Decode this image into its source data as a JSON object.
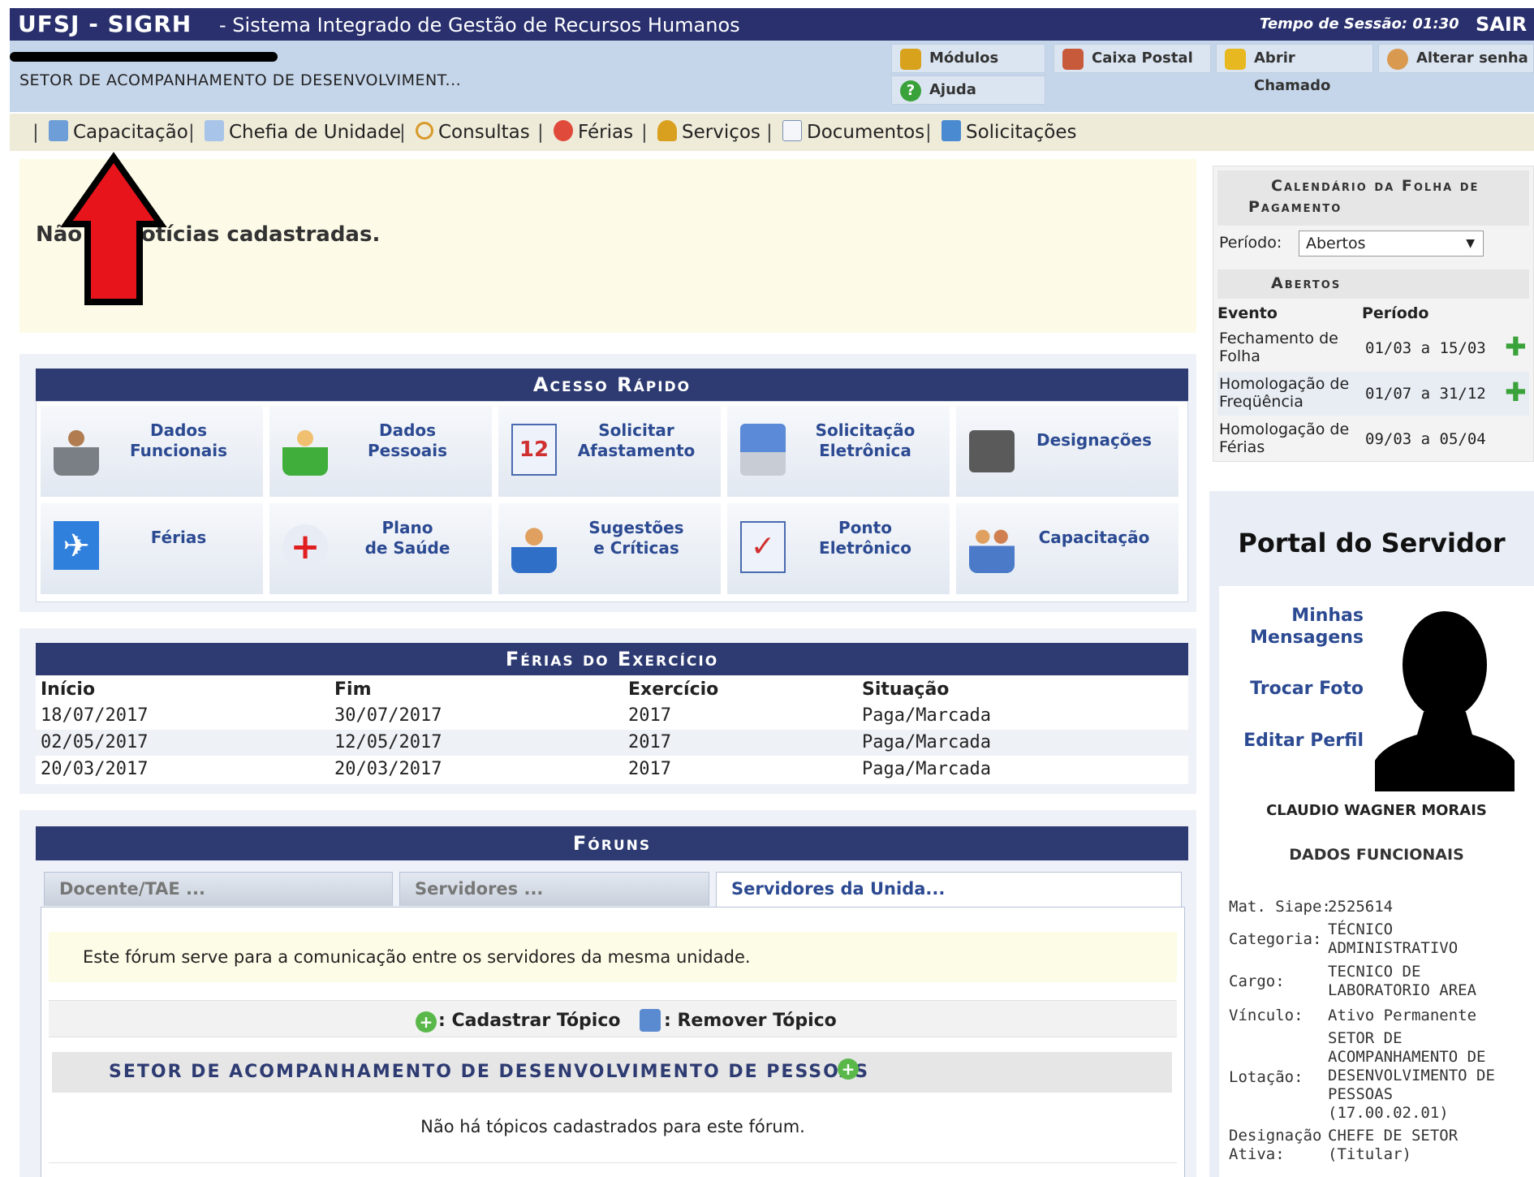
{
  "topbar": {
    "title": "UFSJ - SIGRH",
    "subtitle": "- Sistema Integrado de Gestão de Recursos Humanos",
    "session_label": "Tempo de Sessão: 01:30",
    "logout": "SAIR"
  },
  "header": {
    "setor": "SETOR DE ACOMPANHAMENTO DE DESENVOLVIMENT...",
    "buttons": {
      "modulos": "Módulos",
      "caixa": "Caixa Postal",
      "chamado": "Abrir Chamado",
      "senha": "Alterar senha",
      "ajuda": "Ajuda"
    }
  },
  "menu": {
    "items": [
      "Capacitação",
      "Chefia de Unidade",
      "Consultas",
      "Férias",
      "Serviços",
      "Documentos",
      "Solicitações"
    ],
    "separator": "|"
  },
  "news": {
    "empty": "Não há notícias cadastradas."
  },
  "quick": {
    "title": "Acesso Rápido",
    "tiles": [
      "Dados\nFuncionais",
      "Dados\nPessoais",
      "Solicitar\nAfastamento",
      "Solicitação\nEletrônica",
      "Designações",
      "Férias",
      "Plano\nde Saúde",
      "Sugestões\ne Críticas",
      "Ponto\nEletrônico",
      "Capacitação"
    ]
  },
  "ferias": {
    "title": "Férias do Exercício",
    "columns": [
      "Início",
      "Fim",
      "Exercício",
      "Situação"
    ],
    "rows": [
      [
        "18/07/2017",
        "30/07/2017",
        "2017",
        "Paga/Marcada"
      ],
      [
        "02/05/2017",
        "12/05/2017",
        "2017",
        "Paga/Marcada"
      ],
      [
        "20/03/2017",
        "20/03/2017",
        "2017",
        "Paga/Marcada"
      ]
    ]
  },
  "forums": {
    "title": "Fóruns",
    "tabs": [
      "Docente/TAE ...",
      "Servidores ...",
      "Servidores da Unida..."
    ],
    "description": "Este fórum serve para a comunicação entre os servidores da mesma unidade.",
    "add_topic": ": Cadastrar Tópico",
    "remove_topic": ": Remover Tópico",
    "section_title": "SETOR DE ACOMPANHAMENTO DE DESENVOLVIMENTO DE PESSOAS",
    "empty": "Não há tópicos cadastrados para este fórum."
  },
  "calendar": {
    "title_line1": "Calendário da Folha de",
    "title_line2": "Pagamento",
    "period_label": "Período:",
    "period_value": "Abertos",
    "section": "Abertos",
    "columns": [
      "Evento",
      "Período"
    ],
    "rows": [
      {
        "evento": "Fechamento de\nFolha",
        "periodo": "01/03 a 15/03",
        "plus": true
      },
      {
        "evento": "Homologação de\nFreqüência",
        "periodo": "01/07 a 31/12",
        "plus": true
      },
      {
        "evento": "Homologação de\nFérias",
        "periodo": "09/03 a 05/04",
        "plus": false
      }
    ]
  },
  "portal": {
    "title": "Portal do Servidor",
    "links": [
      "Minhas\nMensagens",
      "Trocar Foto",
      "Editar Perfil"
    ],
    "name": "CLAUDIO WAGNER MORAIS",
    "section": "DADOS FUNCIONAIS",
    "fields": [
      {
        "label": "Mat. Siape:",
        "value": "2525614"
      },
      {
        "label": "Categoria:",
        "value": "TÉCNICO\nADMINISTRATIVO"
      },
      {
        "label": "Cargo:",
        "value": "TECNICO DE\nLABORATORIO AREA"
      },
      {
        "label": "Vínculo:",
        "value": "Ativo Permanente"
      },
      {
        "label": "Lotação:",
        "value": "SETOR DE\nACOMPANHAMENTO DE\nDESENVOLVIMENTO DE\nPESSOAS\n(17.00.02.01)"
      },
      {
        "label": "Designação\nAtiva:",
        "value": "CHEFE DE SETOR\n(Titular)"
      }
    ]
  },
  "colors": {
    "navy": "#2d3b72",
    "header_bg": "#c5d5ea",
    "menu_bg": "#efebd9",
    "news_bg": "#fdfbe8",
    "link": "#2c4a92",
    "arrow": "#e8141b"
  }
}
